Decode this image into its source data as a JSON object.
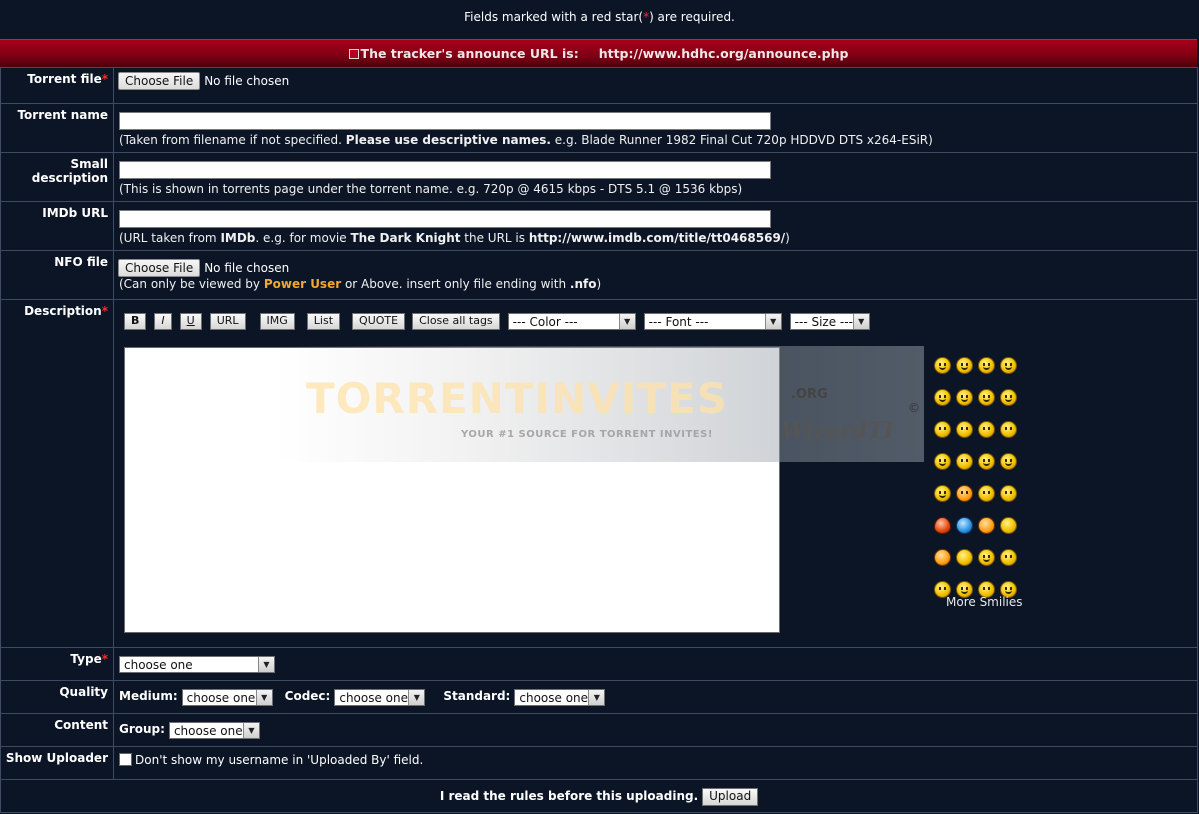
{
  "topnote": {
    "pre": "Fields marked with a red star(",
    "star": "*",
    "post": ") are required."
  },
  "announce": {
    "label": "The tracker's announce URL is:",
    "url": "http://www.hdhc.org/announce.php"
  },
  "rows": {
    "torrent_file": {
      "label": "Torrent file",
      "button": "Choose File",
      "status": "No file chosen"
    },
    "torrent_name": {
      "label": "Torrent name",
      "hint_pre": "(Taken from filename if not specified. ",
      "hint_bold": "Please use descriptive names.",
      "hint_post": " e.g. Blade Runner 1982 Final Cut 720p HDDVD DTS x264-ESiR)"
    },
    "small_desc": {
      "label": "Small description",
      "hint": "(This is shown in torrents page under the torrent name. e.g. 720p @ 4615 kbps - DTS 5.1 @ 1536 kbps)"
    },
    "imdb": {
      "label": "IMDb URL",
      "h1": "(URL taken from ",
      "h2": "IMDb",
      "h3": ". e.g. for movie ",
      "h4": "The Dark Knight",
      "h5": " the URL is ",
      "h6": "http://www.imdb.com/title/tt0468569/",
      "h7": ")"
    },
    "nfo": {
      "label": "NFO file",
      "button": "Choose File",
      "status": "No file chosen",
      "h1": "(Can only be viewed by ",
      "h2": "Power User",
      "h3": " or Above. insert only file ending with ",
      "h4": ".nfo",
      "h5": ")"
    },
    "description": {
      "label": "Description",
      "toolbar": {
        "bold": "B",
        "italic": "I",
        "underline": "U",
        "url": "URL",
        "img": "IMG",
        "list": "List",
        "quote": "QUOTE",
        "close": "Close all tags",
        "color": "--- Color ---",
        "font": "--- Font ---",
        "size": "--- Size ---"
      },
      "watermark": {
        "big": "TORRENTINVITES",
        "org": ".ORG",
        "sub": "YOUR #1 SOURCE FOR TORRENT INVITES!",
        "wiz": "WizardTI",
        "copy": "©"
      },
      "more_smilies": "More Smilies"
    },
    "type": {
      "label": "Type",
      "value": "choose one"
    },
    "quality": {
      "label": "Quality",
      "medium_label": "Medium:",
      "medium_value": "choose one",
      "codec_label": "Codec:",
      "codec_value": "choose one",
      "standard_label": "Standard:",
      "standard_value": "choose one"
    },
    "content": {
      "label": "Content",
      "group_label": "Group:",
      "group_value": "choose one"
    },
    "uploader": {
      "label": "Show Uploader",
      "checkbox_text": "Don't show my username in 'Uploaded By' field."
    }
  },
  "footer": {
    "text": "I read the rules before this uploading.",
    "button": "Upload"
  },
  "colors": {
    "background": "#0b1526",
    "banner": "#8c0018",
    "required_star": "#ff2a2a",
    "power_user": "#f0a830"
  }
}
